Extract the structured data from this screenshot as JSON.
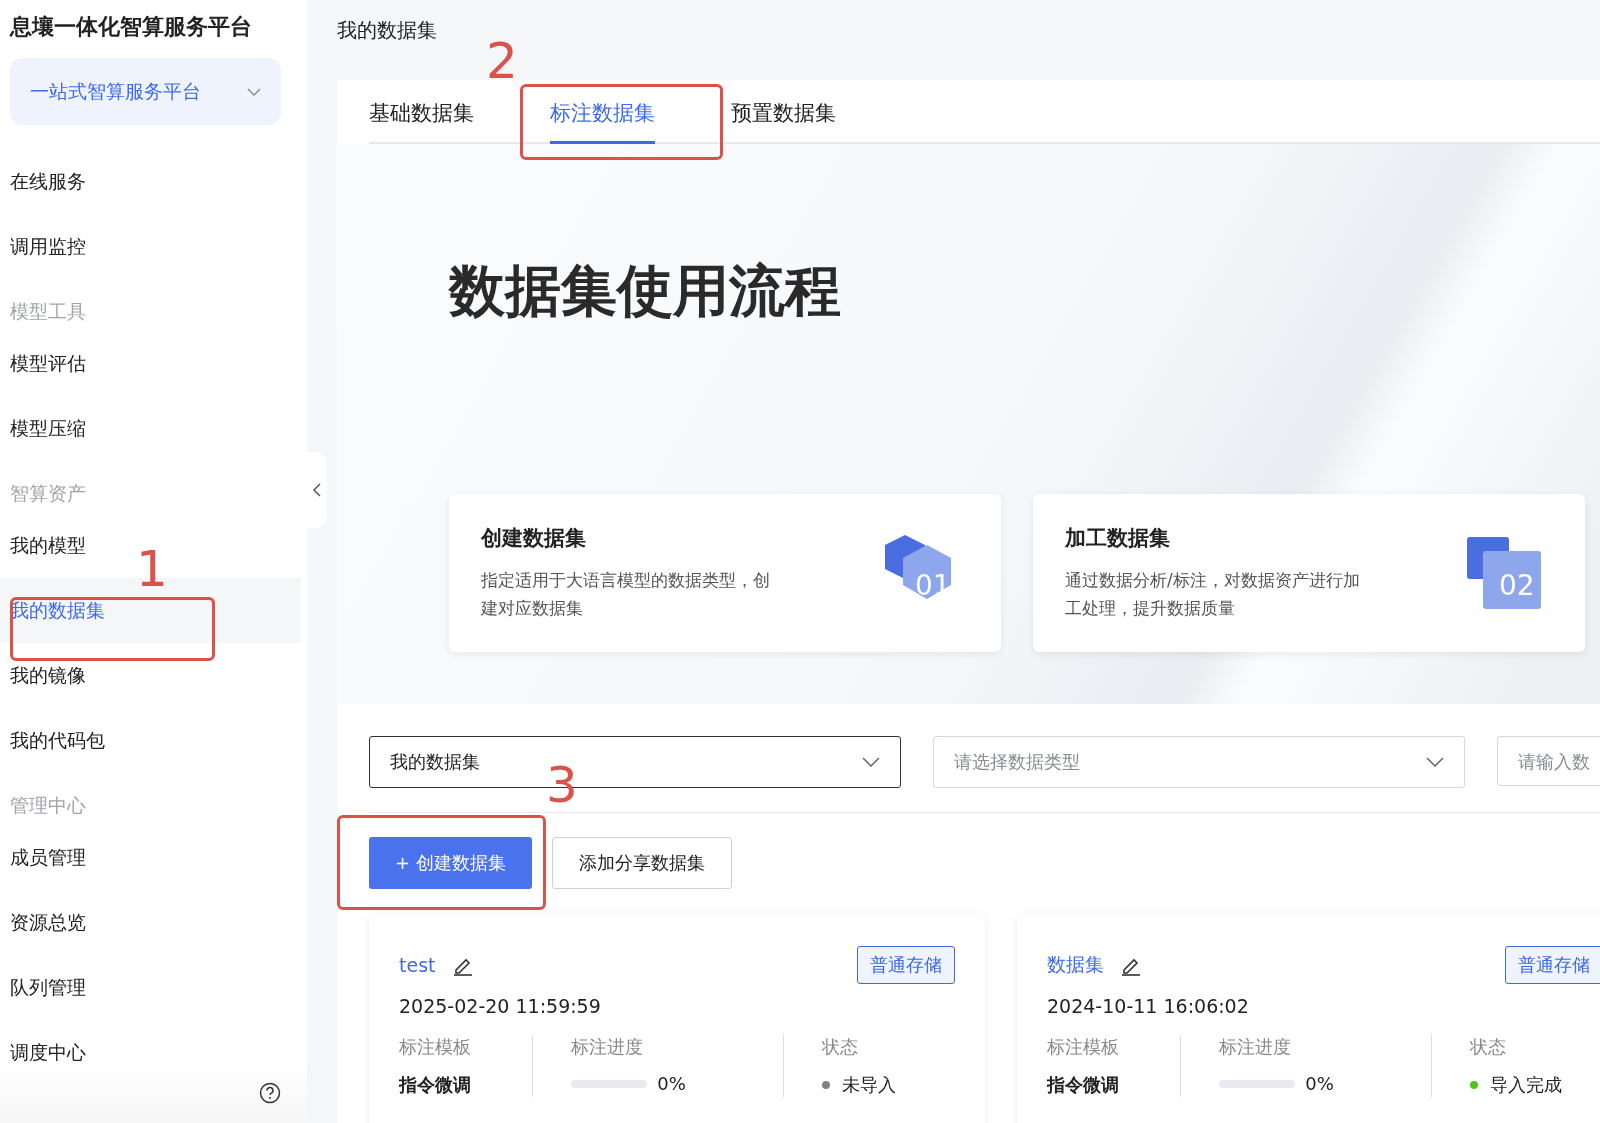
{
  "sidebar": {
    "title": "息壤一体化智算服务平台",
    "platform_select": {
      "value": "一站式智算服务平台"
    },
    "items": [
      {
        "kind": "item",
        "label": "在线服务",
        "selected": false
      },
      {
        "kind": "item",
        "label": "调用监控",
        "selected": false
      },
      {
        "kind": "group",
        "label": "模型工具"
      },
      {
        "kind": "item",
        "label": "模型评估",
        "selected": false
      },
      {
        "kind": "item",
        "label": "模型压缩",
        "selected": false
      },
      {
        "kind": "group",
        "label": "智算资产"
      },
      {
        "kind": "item",
        "label": "我的模型",
        "selected": false
      },
      {
        "kind": "item",
        "label": "我的数据集",
        "selected": true
      },
      {
        "kind": "item",
        "label": "我的镜像",
        "selected": false
      },
      {
        "kind": "item",
        "label": "我的代码包",
        "selected": false
      },
      {
        "kind": "group",
        "label": "管理中心"
      },
      {
        "kind": "item",
        "label": "成员管理",
        "selected": false
      },
      {
        "kind": "item",
        "label": "资源总览",
        "selected": false
      },
      {
        "kind": "item",
        "label": "队列管理",
        "selected": false
      },
      {
        "kind": "item",
        "label": "调度中心",
        "selected": false
      }
    ]
  },
  "breadcrumb": "我的数据集",
  "tabs": [
    {
      "label": "基础数据集",
      "selected": false
    },
    {
      "label": "标注数据集",
      "selected": true
    },
    {
      "label": "预置数据集",
      "selected": false
    }
  ],
  "hero": {
    "title": "数据集使用流程",
    "steps": [
      {
        "kind": "hexagon",
        "title": "创建数据集",
        "text": "指定适用于大语言模型的数据类型，创建对应数据集",
        "number": "01"
      },
      {
        "kind": "square",
        "title": "加工数据集",
        "text": "通过数据分析/标注，对数据资产进行加工处理，提升数据质量",
        "number": "02"
      }
    ]
  },
  "filters": {
    "scope_select": {
      "value": "我的数据集"
    },
    "type_select": {
      "placeholder": "请选择数据类型"
    },
    "search": {
      "placeholder": "请输入数"
    }
  },
  "buttons": [
    {
      "kind": "primary",
      "label": "+ 创建数据集"
    },
    {
      "kind": "default",
      "label": "添加分享数据集"
    }
  ],
  "datasets": [
    {
      "name": "test",
      "tag": "普通存储",
      "date": "2025-02-20 11:59:59",
      "template_label": "标注模板",
      "template": "指令微调",
      "progress_label": "标注进度",
      "level": 0,
      "progress": "0%",
      "status_label": "状态",
      "status": "未导入",
      "color": "#80838a"
    },
    {
      "name": "数据集",
      "tag": "普通存储",
      "date": "2024-10-11 16:06:02",
      "template_label": "标注模板",
      "template": "指令微调",
      "progress_label": "标注进度",
      "level": 0,
      "progress": "0%",
      "status_label": "状态",
      "status": "导入完成",
      "color": "#52c41a"
    }
  ],
  "annotations": [
    {
      "label": "1"
    },
    {
      "label": "2"
    },
    {
      "label": "3"
    }
  ]
}
